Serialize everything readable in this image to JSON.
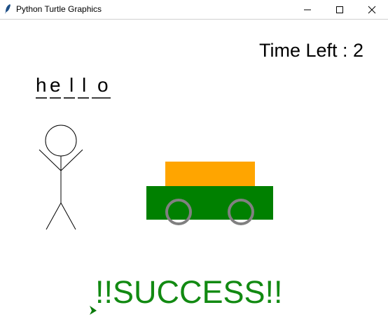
{
  "window": {
    "title": "Python Turtle Graphics"
  },
  "game": {
    "time_left": "Time Left : 2",
    "word_letters": [
      "h",
      "e",
      "l",
      "l",
      "o"
    ],
    "message": "!!SUCCESS!!"
  },
  "colors": {
    "car_body": "#008000",
    "car_cabin": "#ffa500",
    "wheels": "#808080",
    "success_text": "#128a12",
    "turtle": "#0a7a0a"
  },
  "icons": {
    "app": "feather-icon",
    "minimize": "minimize-icon",
    "maximize": "maximize-icon",
    "close": "close-icon"
  }
}
